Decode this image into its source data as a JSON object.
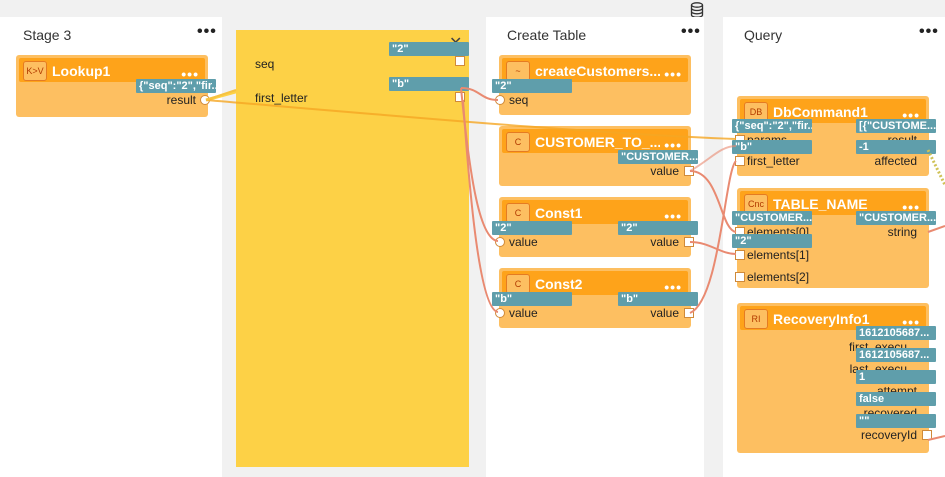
{
  "top_icon": "database-icon",
  "stages": [
    {
      "title": "Stage 3",
      "menu": "•••"
    },
    {
      "title": "Create Table",
      "menu": "•••"
    },
    {
      "title": "Query",
      "menu": "•••"
    }
  ],
  "panel": {
    "close": "✕",
    "fields": [
      {
        "label": "seq",
        "value": "\"2\""
      },
      {
        "label": "first_letter",
        "value": "\"b\""
      }
    ]
  },
  "nodes": {
    "lookup1": {
      "icon": "K>V",
      "title": "Lookup1",
      "menu": "•••",
      "out_tag": "{\"seq\":\"2\",\"fir...",
      "out_label": "result"
    },
    "create_customers": {
      "icon": "~",
      "title": "createCustomers...",
      "menu": "•••",
      "in_tag": "\"2\"",
      "in_label": "seq"
    },
    "customer_to": {
      "icon": "C",
      "title": "CUSTOMER_TO_...",
      "menu": "•••",
      "out_tag": "\"CUSTOMER...",
      "out_label": "value"
    },
    "const1": {
      "icon": "C",
      "title": "Const1",
      "menu": "•••",
      "in_tag": "\"2\"",
      "in_label": "value",
      "out_tag": "\"2\"",
      "out_label": "value"
    },
    "const2": {
      "icon": "C",
      "title": "Const2",
      "menu": "•••",
      "in_tag": "\"b\"",
      "in_label": "value",
      "out_tag": "\"b\"",
      "out_label": "value"
    },
    "dbcommand1": {
      "icon": "DB",
      "title": "DbCommand1",
      "menu": "•••",
      "in1_tag": "{\"seq\":\"2\",\"fir...",
      "in1_label": "params",
      "in2_tag": "\"b\"",
      "in2_label": "first_letter",
      "out1_tag": "[{\"CUSTOME...",
      "out1_label": "result",
      "out2_tag": "-1",
      "out2_label": "affected"
    },
    "table_name": {
      "icon": "Cnc",
      "title": "TABLE_NAME",
      "menu": "•••",
      "in1_tag": "\"CUSTOMER...",
      "in1_label": "elements[0]",
      "in2_tag": "\"2\"",
      "in2_label": "elements[1]",
      "in3_label": "elements[2]",
      "out_tag": "\"CUSTOMER...",
      "out_label": "string"
    },
    "recovery": {
      "icon": "RI",
      "title": "RecoveryInfo1",
      "menu": "•••",
      "outs": [
        {
          "tag": "1612105687...",
          "label": "first_execu..."
        },
        {
          "tag": "1612105687...",
          "label": "last_execu..."
        },
        {
          "tag": "1",
          "label": "attempt"
        },
        {
          "tag": "false",
          "label": "recovered"
        },
        {
          "tag": "\"\"",
          "label": "recoveryId"
        }
      ]
    }
  }
}
